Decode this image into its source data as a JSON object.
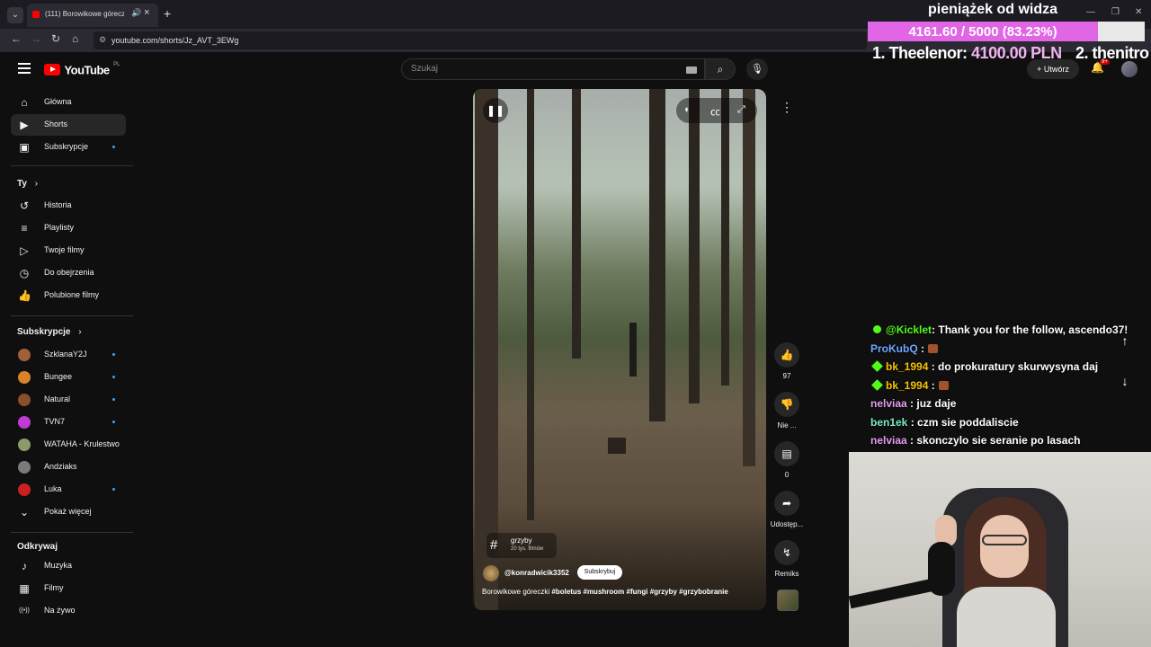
{
  "browser": {
    "tab_title": "(111) Borowikowe góreczki",
    "url": "youtube.com/shorts/Jz_AVT_3EWg"
  },
  "overlay": {
    "donation_title": "pieniążek od widza",
    "donation_progress": 0.8323,
    "donation_progress_text": "4161.60 / 5000 (83.23%)",
    "rank1_label": "1. Theelenor:",
    "rank1_amount": "4100.00 PLN",
    "rank2_label": "2. thenitro"
  },
  "header": {
    "logo_text": "YouTube",
    "logo_region": "PL",
    "search_placeholder": "Szukaj",
    "create_label": "Utwórz",
    "notif_badge": "9+"
  },
  "sidebar": {
    "main": [
      {
        "label": "Główna",
        "icon": "home-icon"
      },
      {
        "label": "Shorts",
        "icon": "shorts-icon",
        "active": true
      },
      {
        "label": "Subskrypcje",
        "icon": "subscriptions-icon",
        "dot": true
      }
    ],
    "you_header": "Ty",
    "you": [
      {
        "label": "Historia",
        "icon": "history-icon"
      },
      {
        "label": "Playlisty",
        "icon": "playlist-icon"
      },
      {
        "label": "Twoje filmy",
        "icon": "your-videos-icon"
      },
      {
        "label": "Do obejrzenia",
        "icon": "watch-later-icon"
      },
      {
        "label": "Polubione filmy",
        "icon": "like-icon"
      }
    ],
    "subs_header": "Subskrypcje",
    "subs": [
      {
        "label": "SzklanaY2J",
        "color": "#a0603a",
        "dot": true
      },
      {
        "label": "Bungee",
        "color": "#d9822b",
        "dot": true
      },
      {
        "label": "Natural",
        "color": "#8a4f2a",
        "dot": true
      },
      {
        "label": "TVN7",
        "color": "#c23ad6",
        "dot": true
      },
      {
        "label": "WATAHA - Krulestwo",
        "color": "#8c9a6a",
        "dot": false
      },
      {
        "label": "Andziaks",
        "color": "#7a7a7a",
        "dot": false
      },
      {
        "label": "Luka",
        "color": "#cc2020",
        "dot": true
      }
    ],
    "show_more": "Pokaż więcej",
    "explore_header": "Odkrywaj",
    "explore": [
      {
        "label": "Muzyka",
        "icon": "music-icon"
      },
      {
        "label": "Filmy",
        "icon": "film-icon"
      },
      {
        "label": "Na żywo",
        "icon": "live-icon"
      }
    ]
  },
  "video": {
    "tag_name": "grzyby",
    "tag_count": "20 tys. filmów",
    "channel": "@konradwicik3352",
    "subscribe_label": "Subskrybuj",
    "description_plain": "Borowikowe góreczki ",
    "description_tags": "#boletus #mushroom #fungi #grzyby #grzybobranie"
  },
  "actions": {
    "likes": "97",
    "dislike_label": "Nie ...",
    "comments": "0",
    "share_label": "Udostęp...",
    "remix_label": "Remiks"
  },
  "chat": [
    {
      "user": "@Kicklet",
      "color": "#53fc18",
      "badge": "check",
      "text": ": Thank you for the follow, ascendo37!"
    },
    {
      "user": "ProKubQ",
      "color": "#6fa8ff",
      "badge": "",
      "text": " :",
      "emote": true
    },
    {
      "user": "bk_1994",
      "color": "#f5c400",
      "badge": "diamond",
      "text": " : do prokuratury skurwysyna daj"
    },
    {
      "user": "bk_1994",
      "color": "#f5c400",
      "badge": "diamond",
      "text": " :",
      "emote": true
    },
    {
      "user": "nelviaa",
      "color": "#e59cf0",
      "badge": "",
      "text": " : juz daje"
    },
    {
      "user": "ben1ek",
      "color": "#7ee8c8",
      "badge": "",
      "text": " : czm sie poddaliscie"
    },
    {
      "user": "nelviaa",
      "color": "#e59cf0",
      "badge": "",
      "text": " : skonczylo sie seranie po lasach"
    }
  ]
}
